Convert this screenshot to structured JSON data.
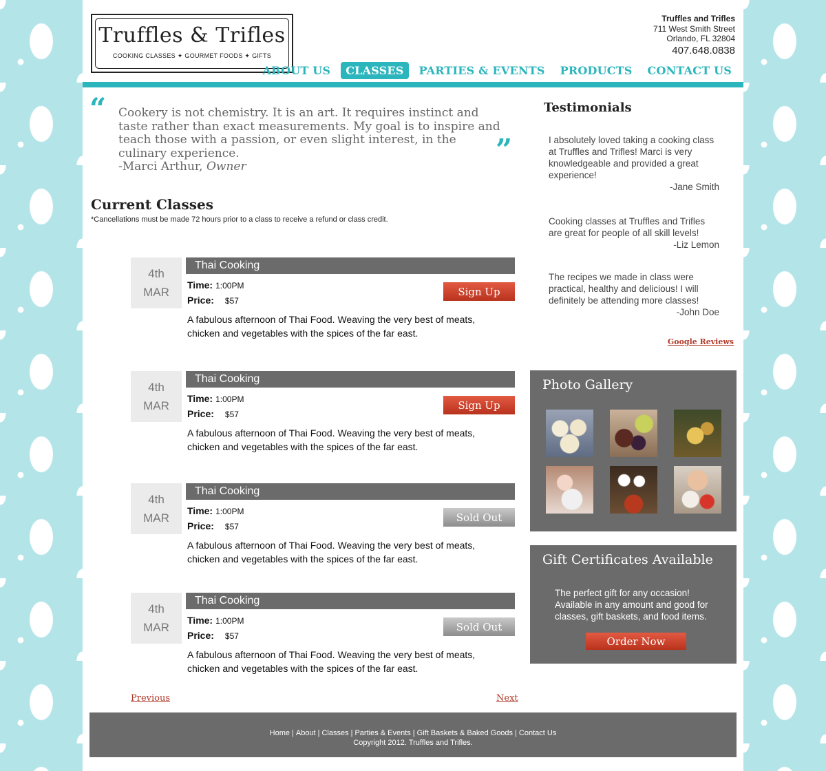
{
  "brand": {
    "name": "Truffles & Trifles",
    "tagline": "COOKING CLASSES ✦ GOURMET FOODS ✦ GIFTS"
  },
  "address": {
    "business": "Truffles and Trifles",
    "street": "711 West Smith Street",
    "city": "Orlando, FL 32804",
    "phone": "407.648.0838"
  },
  "nav": {
    "items": [
      {
        "label": "ABOUT US",
        "active": false
      },
      {
        "label": "CLASSES",
        "active": true
      },
      {
        "label": "PARTIES & EVENTS",
        "active": false
      },
      {
        "label": "PRODUCTS",
        "active": false
      },
      {
        "label": "CONTACT US",
        "active": false
      }
    ]
  },
  "quote": {
    "open_mark": "“",
    "close_mark": "”",
    "text": "Cookery is not chemistry. It is an art. It requires instinct and taste rather than exact measurements. My goal is to inspire and teach those with a passion, or even slight interest, in the culinary experience.",
    "author": "-Marci Arthur,",
    "role": "Owner"
  },
  "classes": {
    "title": "Current Classes",
    "note": "*Cancellations must be made 72 hours prior to a class to receive a refund or class credit.",
    "time_label": "Time:",
    "price_label": "Price:",
    "items": [
      {
        "day": "4th",
        "month": "MAR",
        "name": "Thai Cooking",
        "time": "1:00PM",
        "price": "$57",
        "description": "A fabulous afternoon of Thai Food.  Weaving the very best of meats, chicken and vegetables with the spices of the far east.",
        "button": "Sign Up",
        "status": "open"
      },
      {
        "day": "4th",
        "month": "MAR",
        "name": "Thai Cooking",
        "time": "1:00PM",
        "price": "$57",
        "description": "A fabulous afternoon of Thai Food.  Weaving the very best of meats, chicken and vegetables with the spices of the far east.",
        "button": "Sign Up",
        "status": "open"
      },
      {
        "day": "4th",
        "month": "MAR",
        "name": "Thai Cooking",
        "time": "1:00PM",
        "price": "$57",
        "description": "A fabulous afternoon of Thai Food.  Weaving the very best of meats, chicken and vegetables with the spices of the far east.",
        "button": "Sold Out",
        "status": "sold-out"
      },
      {
        "day": "4th",
        "month": "MAR",
        "name": "Thai Cooking",
        "time": "1:00PM",
        "price": "$57",
        "description": "A fabulous afternoon of Thai Food.  Weaving the very best of meats, chicken and vegetables with the spices of the far east.",
        "button": "Sold Out",
        "status": "sold-out"
      }
    ]
  },
  "pager": {
    "previous": "Previous",
    "next": "Next"
  },
  "testimonials": {
    "title": "Testimonials",
    "items": [
      {
        "text": "I absolutely loved taking a cooking class at Truffles and Trifles! Marci is very knowledgeable and provided a great experience!",
        "author": "-Jane Smith"
      },
      {
        "text": "Cooking classes at Truffles and Trifles are great for people of all skill levels!",
        "author": "-Liz Lemon"
      },
      {
        "text": "The recipes we made in class were practical, healthy and delicious! I will definitely be attending more classes!",
        "author": "-John Doe"
      }
    ],
    "reviews_link": "Google Reviews"
  },
  "gallery": {
    "title": "Photo Gallery",
    "photos": [
      "truffles-photo",
      "fruit-and-chocolates-photo",
      "fried-dumplings-photo",
      "kids-cooking-photo",
      "kitchen-class-photo",
      "chopping-vegetables-photo"
    ]
  },
  "gift": {
    "title": "Gift Certificates Available",
    "text": "The perfect gift for any occasion! Available in any amount and good for classes, gift baskets, and food items.",
    "button": "Order Now"
  },
  "footer": {
    "links": [
      "Home",
      "About",
      "Classes",
      "Parties & Events",
      "Gift Baskets & Baked Goods",
      "Contact Us"
    ],
    "separator": "|",
    "copyright": "Copyright 2012. Truffles and Trifles."
  },
  "colors": {
    "accent": "#2bb5bd",
    "panel_gray": "#6b6b6b",
    "button_red": "#c94030",
    "link_red": "#b23b2a"
  }
}
